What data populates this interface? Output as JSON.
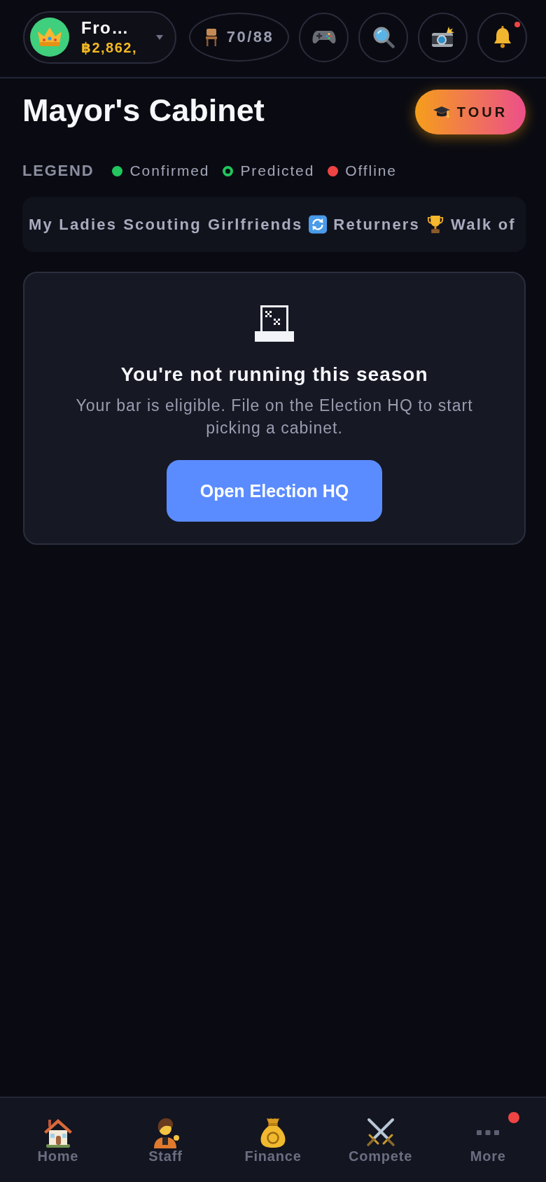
{
  "header": {
    "profile": {
      "name": "Fro…",
      "balance": "฿2,862,"
    },
    "seats": "70/88",
    "actions": [
      {
        "kind": "gamepad",
        "badge": false
      },
      {
        "kind": "search",
        "badge": false
      },
      {
        "kind": "camera",
        "badge": false
      },
      {
        "kind": "bell",
        "badge": true
      }
    ]
  },
  "page": {
    "title": "Mayor's Cabinet",
    "tour_button": "TOUR"
  },
  "legend": {
    "label": "LEGEND",
    "items": [
      {
        "kind": "filled",
        "label": "Confirmed",
        "color": "#22c55e"
      },
      {
        "kind": "ring",
        "label": "Predicted",
        "color": "#22c55e"
      },
      {
        "kind": "filled",
        "label": "Offline",
        "color": "#ef4444"
      }
    ]
  },
  "tabs": [
    {
      "kind": "plain",
      "label": "My Ladies"
    },
    {
      "kind": "plain",
      "label": "Scouting"
    },
    {
      "kind": "plain",
      "label": "Girlfriends"
    },
    {
      "kind": "cycle",
      "label": "Returners"
    },
    {
      "kind": "trophy",
      "label": "Walk of"
    }
  ],
  "empty_state": {
    "title": "You're not running this season",
    "message": "Your bar is eligible. File on the Election HQ to start picking a cabinet.",
    "button": "Open Election HQ"
  },
  "bottom_nav": [
    {
      "kind": "home",
      "label": "Home",
      "badge": false
    },
    {
      "kind": "staff",
      "label": "Staff",
      "badge": false
    },
    {
      "kind": "finance",
      "label": "Finance",
      "badge": false
    },
    {
      "kind": "compete",
      "label": "Compete",
      "badge": false
    },
    {
      "kind": "more",
      "label": "More",
      "badge": true
    }
  ]
}
